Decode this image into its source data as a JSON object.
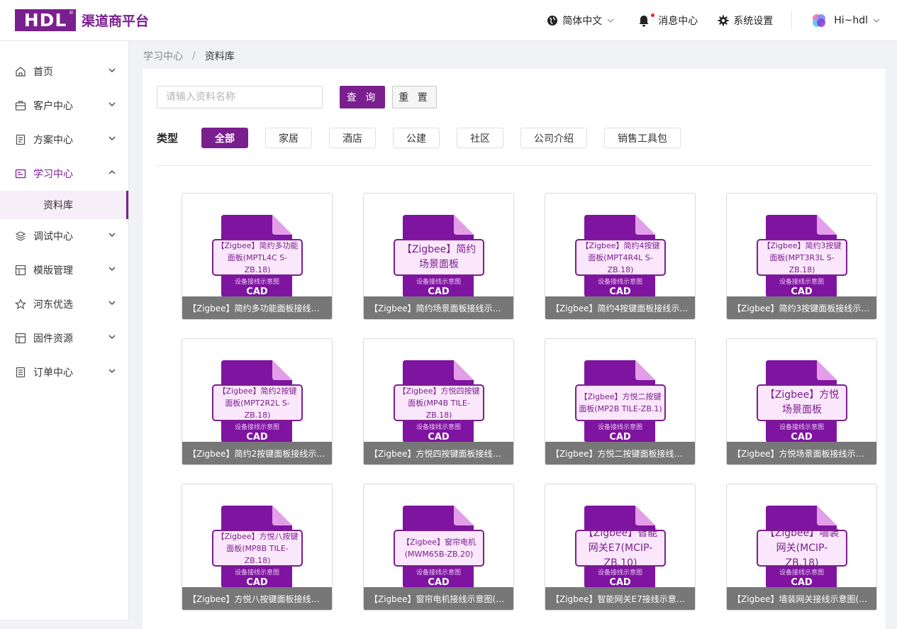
{
  "header": {
    "logo_text": "HDL",
    "platform_name": "渠道商平台",
    "language": "简体中文",
    "messages": "消息中心",
    "settings": "系统设置",
    "user": "Hi~hdl"
  },
  "sidebar": {
    "items": [
      {
        "label": "首页",
        "icon": "home-icon"
      },
      {
        "label": "客户中心",
        "icon": "briefcase-icon"
      },
      {
        "label": "方案中心",
        "icon": "document-icon"
      },
      {
        "label": "学习中心",
        "icon": "book-icon",
        "active": true
      },
      {
        "label": "调试中心",
        "icon": "layers-icon"
      },
      {
        "label": "模版管理",
        "icon": "template-icon"
      },
      {
        "label": "河东优选",
        "icon": "star-icon"
      },
      {
        "label": "固件资源",
        "icon": "firmware-icon"
      },
      {
        "label": "订单中心",
        "icon": "order-icon"
      }
    ],
    "sub_item": "资料库"
  },
  "breadcrumb": {
    "parent": "学习中心",
    "separator": "/",
    "current": "资料库"
  },
  "search": {
    "placeholder": "请输入资料名称",
    "query_label": "查 询",
    "reset_label": "重 置"
  },
  "types": {
    "label": "类型",
    "tags": [
      "全部",
      "家居",
      "酒店",
      "公建",
      "社区",
      "公司介绍",
      "销售工具包"
    ]
  },
  "file_sub": "设备接线示意图",
  "file_ext": "CAD",
  "cards": [
    {
      "icon_text": "【Zigbee】简约多功能面板(MPTL4C S-ZB.18)",
      "big": false,
      "caption": "【Zigbee】简约多功能面板接线示…"
    },
    {
      "icon_text": "【Zigbee】简约场景面板",
      "big": true,
      "caption": "【Zigbee】简约场景面板接线示意图"
    },
    {
      "icon_text": "【Zigbee】简约4按键面板(MPT4R4L S-ZB.18)",
      "big": false,
      "caption": "【Zigbee】简约4按键面板接线示意…"
    },
    {
      "icon_text": "【Zigbee】简约3按键面板(MPT3R3L S-ZB.18)",
      "big": false,
      "caption": "【Zigbee】简约3按键面板接线示意…"
    },
    {
      "icon_text": "【Zigbee】简约2按键面板(MPT2R2L S-ZB.18)",
      "big": false,
      "caption": "【Zigbee】简约2按键面板接线示意…"
    },
    {
      "icon_text": "【Zigbee】方悦四按键面板(MP4B TILE-ZB.18)",
      "big": false,
      "caption": "【Zigbee】方悦四按键面板接线示…"
    },
    {
      "icon_text": "【Zigbee】方悦二按键面板(MP2B TILE-ZB.1)",
      "big": false,
      "caption": "【Zigbee】方悦二按键面板接线示…"
    },
    {
      "icon_text": "【Zigbee】方悦场景面板",
      "big": true,
      "caption": "【Zigbee】方悦场景面板接线示意图"
    },
    {
      "icon_text": "【Zigbee】方悦八按键面板(MP8B TILE-ZB.18)",
      "big": false,
      "caption": "【Zigbee】方悦八按键面板接线示…"
    },
    {
      "icon_text": "【Zigbee】窗帘电机(MWM65B-ZB.20)",
      "big": false,
      "caption": "【Zigbee】窗帘电机接线示意图(M…"
    },
    {
      "icon_text": "【Zigbee】智能网关E7(MCIP-ZB.10)",
      "big": true,
      "caption": "【Zigbee】智能网关E7接线示意图(…"
    },
    {
      "icon_text": "【Zigbee】墙装网关(MCIP-ZB.18)",
      "big": true,
      "caption": "【Zigbee】墙装网关接线示意图(M…"
    }
  ]
}
